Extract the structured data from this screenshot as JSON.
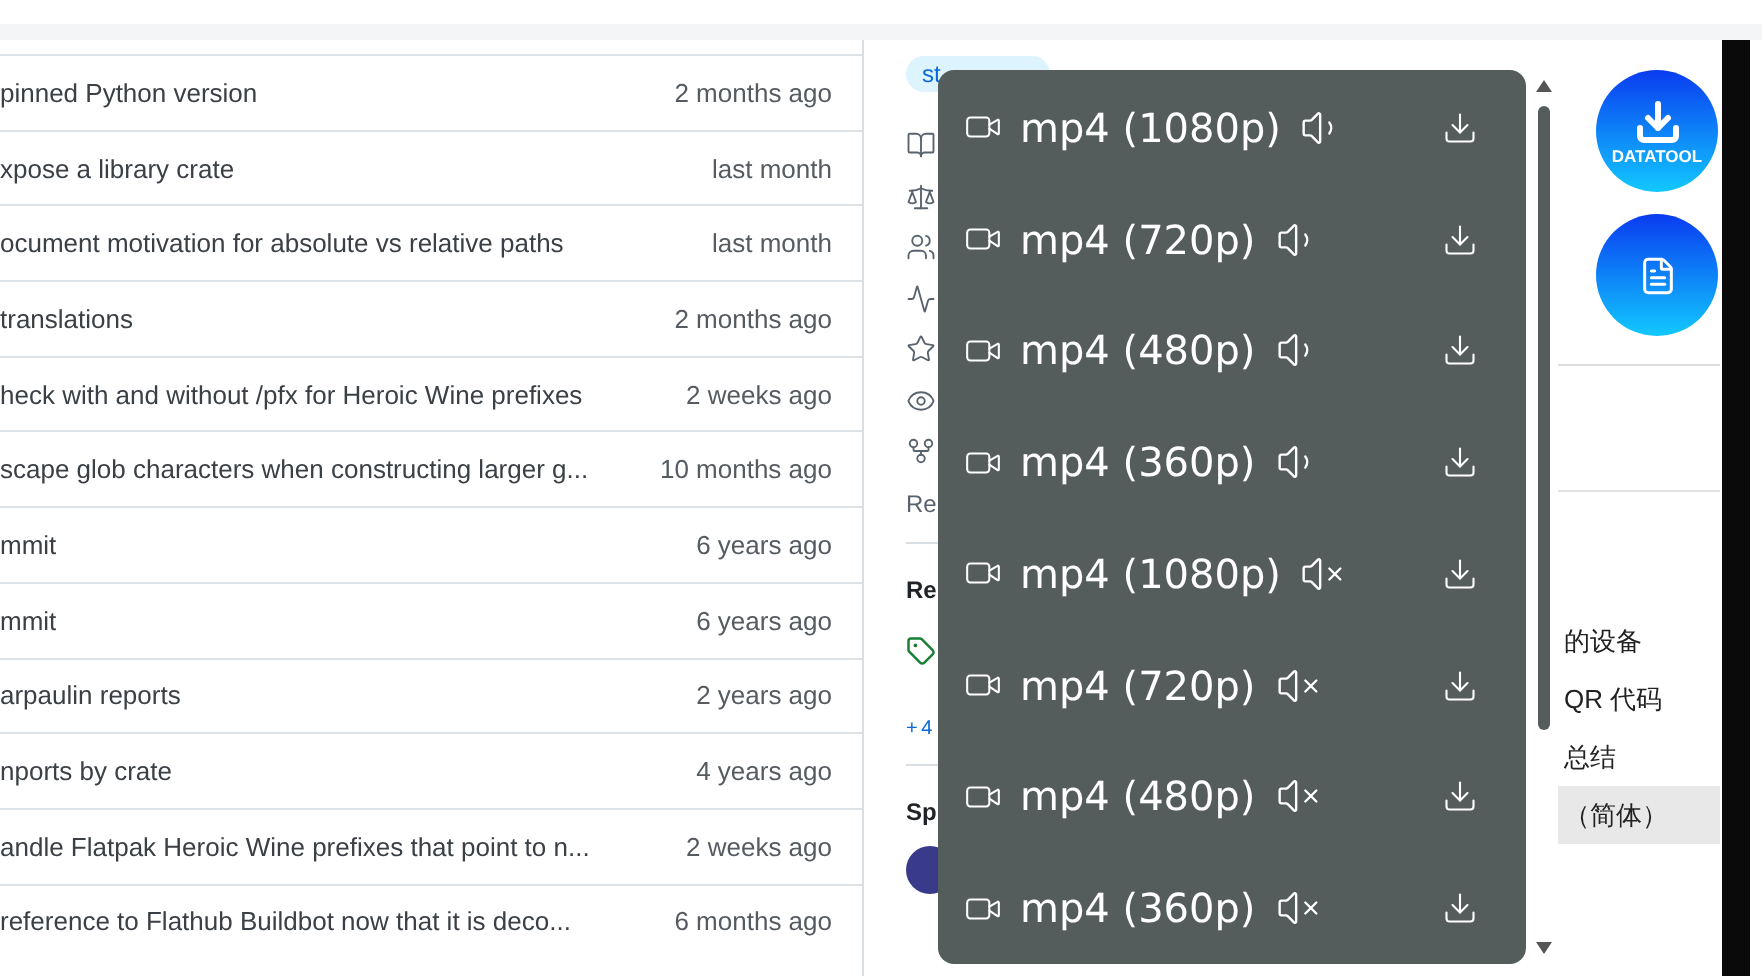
{
  "commits": [
    {
      "message": "pinned Python version",
      "time": "2 months ago"
    },
    {
      "message": "xpose a library crate",
      "time": "last month"
    },
    {
      "message": "ocument motivation for absolute vs relative paths",
      "time": "last month"
    },
    {
      "message": "translations",
      "time": "2 months ago"
    },
    {
      "message": "heck with and without /pfx for Heroic Wine prefixes",
      "time": "2 weeks ago"
    },
    {
      "message": "scape glob characters when constructing larger g...",
      "time": "10 months ago"
    },
    {
      "message": "mmit",
      "time": "6 years ago"
    },
    {
      "message": "mmit",
      "time": "6 years ago"
    },
    {
      "message": "arpaulin reports",
      "time": "2 years ago"
    },
    {
      "message": "nports by crate",
      "time": "4 years ago"
    },
    {
      "message": "andle Flatpak Heroic Wine prefixes that point to n...",
      "time": "2 weeks ago"
    },
    {
      "message": "reference to Flathub Buildbot now that it is deco...",
      "time": "6 months ago"
    }
  ],
  "sidebar": {
    "topics": [
      "st"
    ],
    "readme_link": "Re",
    "releases_heading": "Re",
    "more_link": "+ 4",
    "sponsors_heading": "Sp"
  },
  "formats": [
    {
      "label": "mp4 (1080p)",
      "audio": true
    },
    {
      "label": "mp4 (720p)",
      "audio": true
    },
    {
      "label": "mp4 (480p)",
      "audio": true
    },
    {
      "label": "mp4 (360p)",
      "audio": true
    },
    {
      "label": "mp4 (1080p)",
      "audio": false
    },
    {
      "label": "mp4 (720p)",
      "audio": false
    },
    {
      "label": "mp4 (480p)",
      "audio": false
    },
    {
      "label": "mp4 (360p)",
      "audio": false
    }
  ],
  "fab": {
    "label": "DATATOOL"
  },
  "menu": [
    {
      "label": "的设备",
      "selected": false
    },
    {
      "label": "QR 代码",
      "selected": false
    },
    {
      "label": "总结",
      "selected": false
    },
    {
      "label": "（简体）",
      "selected": true
    }
  ]
}
